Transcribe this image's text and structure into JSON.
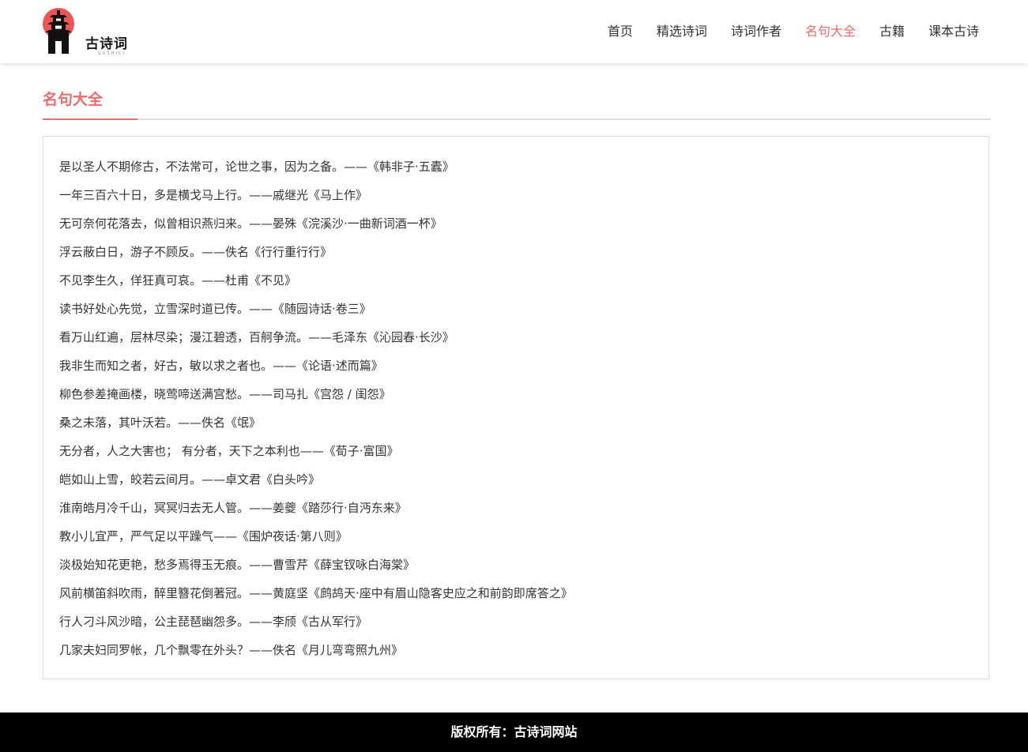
{
  "header": {
    "logo_text": "古诗词",
    "logo_subtext": "GUSHICI",
    "nav": [
      {
        "label": "首页",
        "active": false
      },
      {
        "label": "精选诗词",
        "active": false
      },
      {
        "label": "诗词作者",
        "active": false
      },
      {
        "label": "名句大全",
        "active": true
      },
      {
        "label": "古籍",
        "active": false
      },
      {
        "label": "课本古诗",
        "active": false
      }
    ]
  },
  "main": {
    "section_title": "名句大全",
    "quotes": [
      "是以圣人不期修古，不法常可，论世之事，因为之备。——《韩非子·五蠹》",
      "一年三百六十日，多是横戈马上行。——戚继光《马上作》",
      "无可奈何花落去，似曾相识燕归来。——晏殊《浣溪沙·一曲新词酒一杯》",
      "浮云蔽白日，游子不顾反。——佚名《行行重行行》",
      "不见李生久，佯狂真可哀。——杜甫《不见》",
      "读书好处心先觉，立雪深时道已传。——《随园诗话·卷三》",
      "看万山红遍，层林尽染；漫江碧透，百舸争流。——毛泽东《沁园春·长沙》",
      "我非生而知之者，好古，敏以求之者也。——《论语·述而篇》",
      "柳色参差掩画楼，晓莺啼送满宫愁。——司马扎《宫怨 / 闺怨》",
      "桑之未落，其叶沃若。——佚名《氓》",
      "无分者，人之大害也； 有分者，天下之本利也——《荀子·富国》",
      "皑如山上雪，皎若云间月。——卓文君《白头吟》",
      "淮南皓月冷千山，冥冥归去无人管。——姜夔《踏莎行·自沔东来》",
      "教小儿宜严，严气足以平躁气——《围炉夜话·第八则》",
      "淡极始知花更艳，愁多焉得玉无痕。——曹雪芹《薛宝钗咏白海棠》",
      "风前横笛斜吹雨，醉里簪花倒著冠。——黄庭坚《鹧鸪天·座中有眉山隐客史应之和前韵即席答之》",
      "行人刁斗风沙暗，公主琵琶幽怨多。——李颀《古从军行》",
      "几家夫妇同罗帐，几个飘零在外头？——佚名《月儿弯弯照九州》"
    ]
  },
  "footer": {
    "copyright": "版权所有：古诗词网站"
  },
  "colors": {
    "accent": "#f06a6a",
    "footer_bg": "#000000",
    "border": "#dddddd"
  }
}
